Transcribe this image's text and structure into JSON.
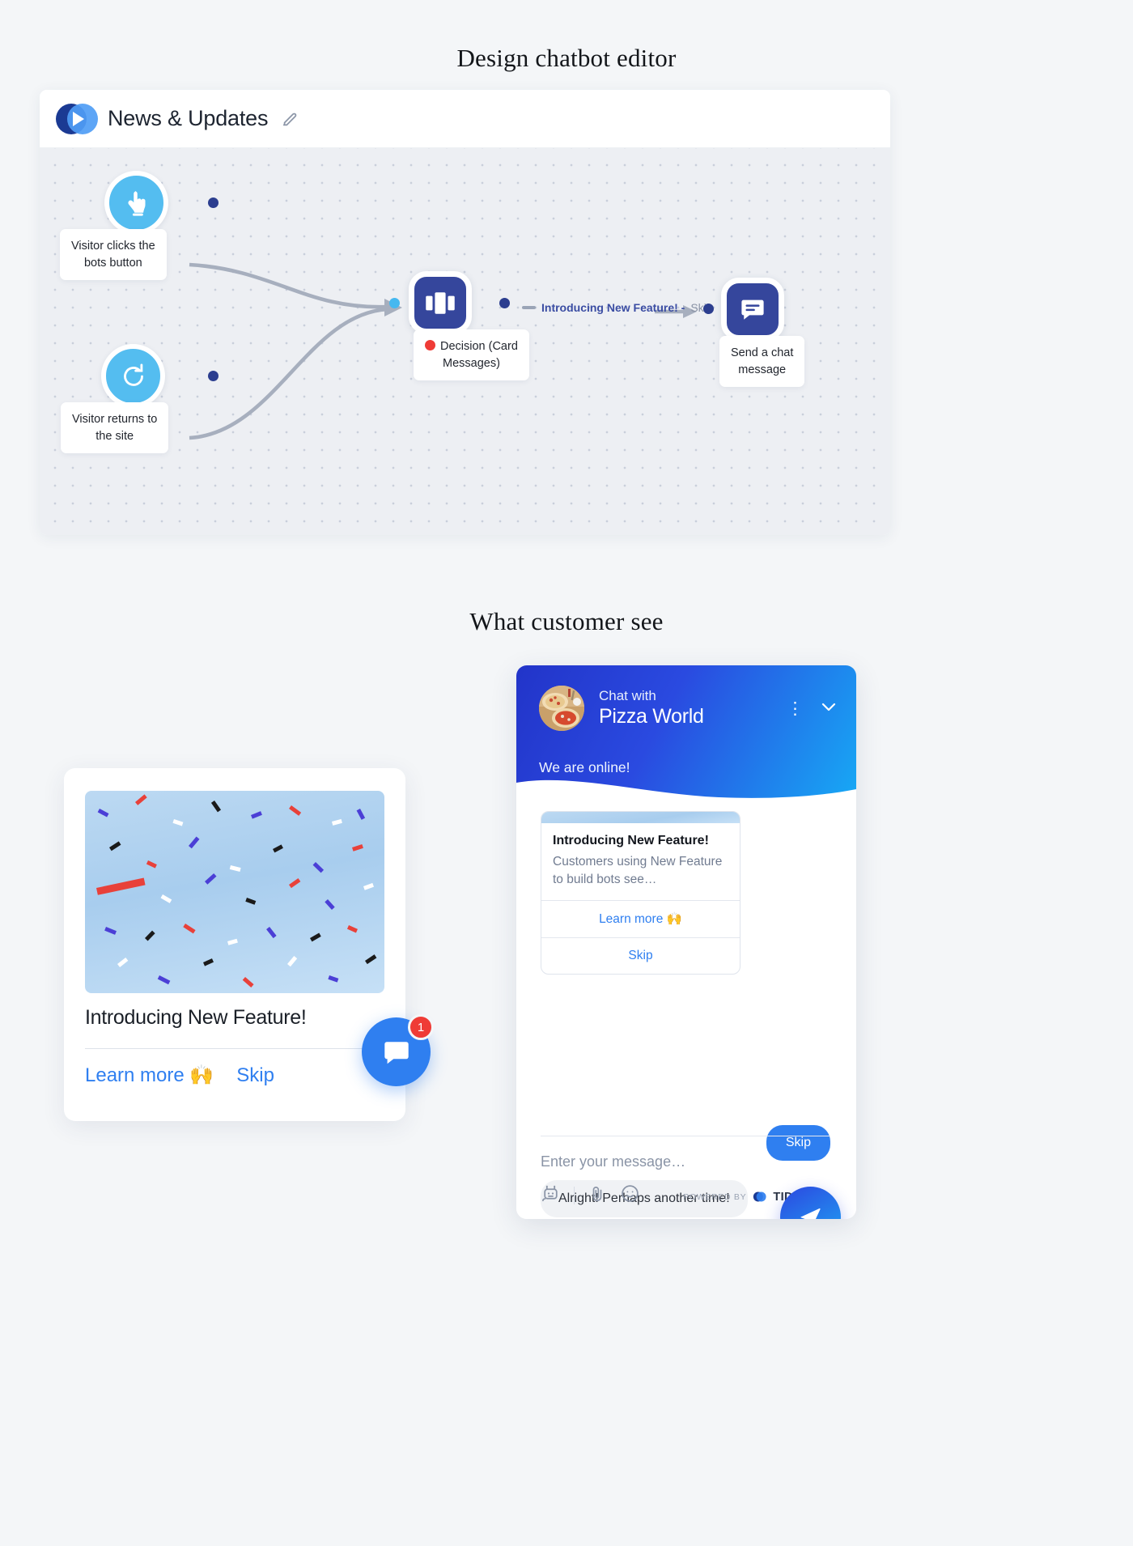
{
  "headings": {
    "editor": "Design chatbot editor",
    "customer": "What customer see"
  },
  "editor": {
    "title": "News & Updates",
    "edit_icon": "pencil-icon",
    "logo_icon": "tidio-bot-logo-icon",
    "nodes": [
      {
        "id": "trigger-click",
        "icon": "tap-finger-icon",
        "label": "Visitor clicks the\nbots button",
        "label_line1": "Visitor clicks the",
        "label_line2": "bots button"
      },
      {
        "id": "trigger-return",
        "icon": "refresh-arrow-icon",
        "label_line1": "Visitor returns to",
        "label_line2": "the site"
      },
      {
        "id": "decision-card",
        "icon": "card-carousel-icon",
        "label_line1": "Decision (Card",
        "label_line2": "Messages)",
        "status_dot": "#ef3b36"
      },
      {
        "id": "send-message",
        "icon": "chat-message-icon",
        "label_line1": "Send a chat",
        "label_line2": "message"
      }
    ],
    "edge_label": {
      "bold": "Introducing New Feature! -",
      "muted": "Skip"
    },
    "colors": {
      "trigger": "#54bdf0",
      "action": "#35469c",
      "port": "#2c3e8f",
      "port_light": "#45b8f0",
      "edge": "#a7afbe"
    }
  },
  "card_preview": {
    "title": "Introducing New Feature!",
    "learn_more": "Learn more 🙌",
    "skip": "Skip",
    "image_alt": "confetti-image"
  },
  "launcher": {
    "icon": "chat-bubble-icon",
    "badge": "1"
  },
  "chat": {
    "header": {
      "chat_with": "Chat with",
      "brand": "Pizza World",
      "status": "We are online!",
      "menu_icon": "kebab-menu-icon",
      "collapse_icon": "chevron-down-icon",
      "avatar_icon": "pizza-avatar"
    },
    "card": {
      "title": "Introducing New Feature!",
      "description": "Customers using New Feature to build bots see…",
      "actions": [
        {
          "label": "Learn more 🙌",
          "name": "learn-more"
        },
        {
          "label": "Skip",
          "name": "skip"
        }
      ]
    },
    "messages": [
      {
        "from": "visitor",
        "text": "Skip"
      },
      {
        "from": "bot",
        "text": "Alright! Perhaps another time!"
      }
    ],
    "input": {
      "placeholder": "Enter your message…",
      "bot_icon": "bot-face-icon",
      "attach_icon": "paperclip-icon",
      "emoji_icon": "smiley-icon",
      "send_icon": "send-paper-plane-icon"
    },
    "footer": {
      "powered_by": "POWERED BY",
      "brand": "TIDIO"
    },
    "colors": {
      "primary": "#2f7ff0",
      "header_start": "#2234c9",
      "header_end": "#17a9f5"
    }
  }
}
